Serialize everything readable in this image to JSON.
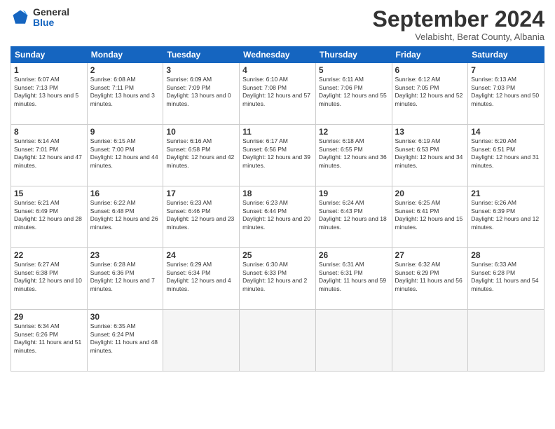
{
  "header": {
    "logo_general": "General",
    "logo_blue": "Blue",
    "month_title": "September 2024",
    "location": "Velabisht, Berat County, Albania"
  },
  "weekdays": [
    "Sunday",
    "Monday",
    "Tuesday",
    "Wednesday",
    "Thursday",
    "Friday",
    "Saturday"
  ],
  "weeks": [
    [
      {
        "day": "1",
        "sunrise": "6:07 AM",
        "sunset": "7:13 PM",
        "daylight": "13 hours and 5 minutes."
      },
      {
        "day": "2",
        "sunrise": "6:08 AM",
        "sunset": "7:11 PM",
        "daylight": "13 hours and 3 minutes."
      },
      {
        "day": "3",
        "sunrise": "6:09 AM",
        "sunset": "7:09 PM",
        "daylight": "13 hours and 0 minutes."
      },
      {
        "day": "4",
        "sunrise": "6:10 AM",
        "sunset": "7:08 PM",
        "daylight": "12 hours and 57 minutes."
      },
      {
        "day": "5",
        "sunrise": "6:11 AM",
        "sunset": "7:06 PM",
        "daylight": "12 hours and 55 minutes."
      },
      {
        "day": "6",
        "sunrise": "6:12 AM",
        "sunset": "7:05 PM",
        "daylight": "12 hours and 52 minutes."
      },
      {
        "day": "7",
        "sunrise": "6:13 AM",
        "sunset": "7:03 PM",
        "daylight": "12 hours and 50 minutes."
      }
    ],
    [
      {
        "day": "8",
        "sunrise": "6:14 AM",
        "sunset": "7:01 PM",
        "daylight": "12 hours and 47 minutes."
      },
      {
        "day": "9",
        "sunrise": "6:15 AM",
        "sunset": "7:00 PM",
        "daylight": "12 hours and 44 minutes."
      },
      {
        "day": "10",
        "sunrise": "6:16 AM",
        "sunset": "6:58 PM",
        "daylight": "12 hours and 42 minutes."
      },
      {
        "day": "11",
        "sunrise": "6:17 AM",
        "sunset": "6:56 PM",
        "daylight": "12 hours and 39 minutes."
      },
      {
        "day": "12",
        "sunrise": "6:18 AM",
        "sunset": "6:55 PM",
        "daylight": "12 hours and 36 minutes."
      },
      {
        "day": "13",
        "sunrise": "6:19 AM",
        "sunset": "6:53 PM",
        "daylight": "12 hours and 34 minutes."
      },
      {
        "day": "14",
        "sunrise": "6:20 AM",
        "sunset": "6:51 PM",
        "daylight": "12 hours and 31 minutes."
      }
    ],
    [
      {
        "day": "15",
        "sunrise": "6:21 AM",
        "sunset": "6:49 PM",
        "daylight": "12 hours and 28 minutes."
      },
      {
        "day": "16",
        "sunrise": "6:22 AM",
        "sunset": "6:48 PM",
        "daylight": "12 hours and 26 minutes."
      },
      {
        "day": "17",
        "sunrise": "6:23 AM",
        "sunset": "6:46 PM",
        "daylight": "12 hours and 23 minutes."
      },
      {
        "day": "18",
        "sunrise": "6:23 AM",
        "sunset": "6:44 PM",
        "daylight": "12 hours and 20 minutes."
      },
      {
        "day": "19",
        "sunrise": "6:24 AM",
        "sunset": "6:43 PM",
        "daylight": "12 hours and 18 minutes."
      },
      {
        "day": "20",
        "sunrise": "6:25 AM",
        "sunset": "6:41 PM",
        "daylight": "12 hours and 15 minutes."
      },
      {
        "day": "21",
        "sunrise": "6:26 AM",
        "sunset": "6:39 PM",
        "daylight": "12 hours and 12 minutes."
      }
    ],
    [
      {
        "day": "22",
        "sunrise": "6:27 AM",
        "sunset": "6:38 PM",
        "daylight": "12 hours and 10 minutes."
      },
      {
        "day": "23",
        "sunrise": "6:28 AM",
        "sunset": "6:36 PM",
        "daylight": "12 hours and 7 minutes."
      },
      {
        "day": "24",
        "sunrise": "6:29 AM",
        "sunset": "6:34 PM",
        "daylight": "12 hours and 4 minutes."
      },
      {
        "day": "25",
        "sunrise": "6:30 AM",
        "sunset": "6:33 PM",
        "daylight": "12 hours and 2 minutes."
      },
      {
        "day": "26",
        "sunrise": "6:31 AM",
        "sunset": "6:31 PM",
        "daylight": "11 hours and 59 minutes."
      },
      {
        "day": "27",
        "sunrise": "6:32 AM",
        "sunset": "6:29 PM",
        "daylight": "11 hours and 56 minutes."
      },
      {
        "day": "28",
        "sunrise": "6:33 AM",
        "sunset": "6:28 PM",
        "daylight": "11 hours and 54 minutes."
      }
    ],
    [
      {
        "day": "29",
        "sunrise": "6:34 AM",
        "sunset": "6:26 PM",
        "daylight": "11 hours and 51 minutes."
      },
      {
        "day": "30",
        "sunrise": "6:35 AM",
        "sunset": "6:24 PM",
        "daylight": "11 hours and 48 minutes."
      },
      null,
      null,
      null,
      null,
      null
    ]
  ]
}
